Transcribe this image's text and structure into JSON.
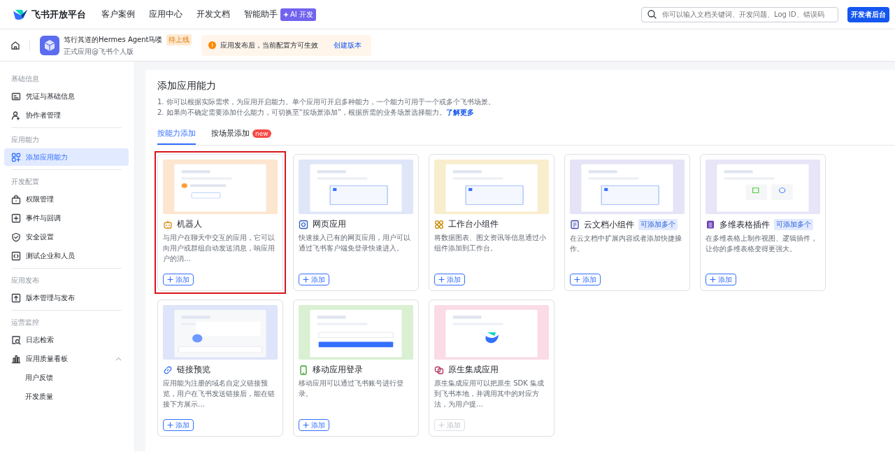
{
  "topnav": {
    "logo": "飞书开放平台",
    "links": [
      "客户案例",
      "应用中心",
      "开发文档",
      "智能助手"
    ],
    "ai_badge": "AI 开发",
    "search": {
      "placeholder": "你可以输入文档关键词、开发问题、Log ID、错误码"
    },
    "console_button": "开发者后台"
  },
  "app_header": {
    "name": "笃行其道的Hermes Agent马喽",
    "status": "待上线",
    "subtitle": "正式应用@飞书个人版",
    "notice": "应用发布后，当前配置方可生效",
    "notice_link": "创建版本"
  },
  "sidebar": {
    "sections": [
      {
        "title": "基础信息",
        "items": [
          {
            "label": "凭证与基础信息",
            "selected": false
          },
          {
            "label": "协作者管理",
            "selected": false
          }
        ]
      },
      {
        "title": "应用能力",
        "items": [
          {
            "label": "添加应用能力",
            "selected": true
          }
        ]
      },
      {
        "title": "开发配置",
        "items": [
          {
            "label": "权限管理",
            "selected": false
          },
          {
            "label": "事件与回调",
            "selected": false
          },
          {
            "label": "安全设置",
            "selected": false
          },
          {
            "label": "测试企业和人员",
            "selected": false
          }
        ]
      },
      {
        "title": "应用发布",
        "items": [
          {
            "label": "版本管理与发布",
            "selected": false
          }
        ]
      },
      {
        "title": "运营监控",
        "items": [
          {
            "label": "日志检索",
            "selected": false
          },
          {
            "label": "应用质量看板",
            "selected": false,
            "expanded": true,
            "children": [
              {
                "label": "用户反馈",
                "selected": false
              },
              {
                "label": "开发质量",
                "selected": false
              }
            ]
          }
        ]
      }
    ]
  },
  "content": {
    "title": "添加应用能力",
    "notes": [
      {
        "text": "1. 你可以根据实际需求，为应用开启能力。单个应用可开启多种能力，一个能力可用于一个或多个飞书场景。"
      },
      {
        "text": "2. 如果尚不确定需要添加什么能力，可切换至“按场景添加”，根据所需的业务场景选择能力。",
        "link": "了解更多"
      }
    ],
    "tabs": [
      {
        "label": "按能力添加",
        "selected": true
      },
      {
        "label": "按场景添加",
        "selected": false,
        "badge": "new"
      }
    ],
    "cards": [
      {
        "title": "机器人",
        "description": "与用户在聊天中交互的应用，它可以向用户或群组自动发送消息，响应用户的消…",
        "add_label": "添加",
        "disabled": false,
        "highlighted": true
      },
      {
        "title": "网页应用",
        "description": "快速接入已有的网页应用，用户可以通过飞书客户端免登录快速进入。",
        "add_label": "添加",
        "disabled": false,
        "highlighted": false
      },
      {
        "title": "工作台小组件",
        "description": "将数据图表、图文资讯等信息通过小组件添加到工作台。",
        "add_label": "添加",
        "disabled": false,
        "highlighted": false
      },
      {
        "title": "云文档小组件",
        "tag": "可添加多个",
        "description": "在云文档中扩展内容或者添加快捷操作。",
        "add_label": "添加",
        "disabled": false,
        "highlighted": false
      },
      {
        "title": "多维表格插件",
        "tag": "可添加多个",
        "description": "在多维表格上制作视图、逻辑插件，让你的多维表格变得更强大。",
        "add_label": "添加",
        "disabled": false,
        "highlighted": false
      },
      {
        "title": "链接预览",
        "description": "应用能为注册的域名自定义链接预览，用户在飞书发送链接后，能在链接下方展示…",
        "add_label": "添加",
        "disabled": false,
        "highlighted": false
      },
      {
        "title": "移动应用登录",
        "description": "移动应用可以通过飞书账号进行登录。",
        "add_label": "添加",
        "disabled": false,
        "highlighted": false
      },
      {
        "title": "原生集成应用",
        "description": "原生集成应用可以把原生 SDK 集成到飞书本地，并调用其中的对应方法，为用户提…",
        "add_label": "添加",
        "disabled": true,
        "highlighted": false
      }
    ]
  }
}
